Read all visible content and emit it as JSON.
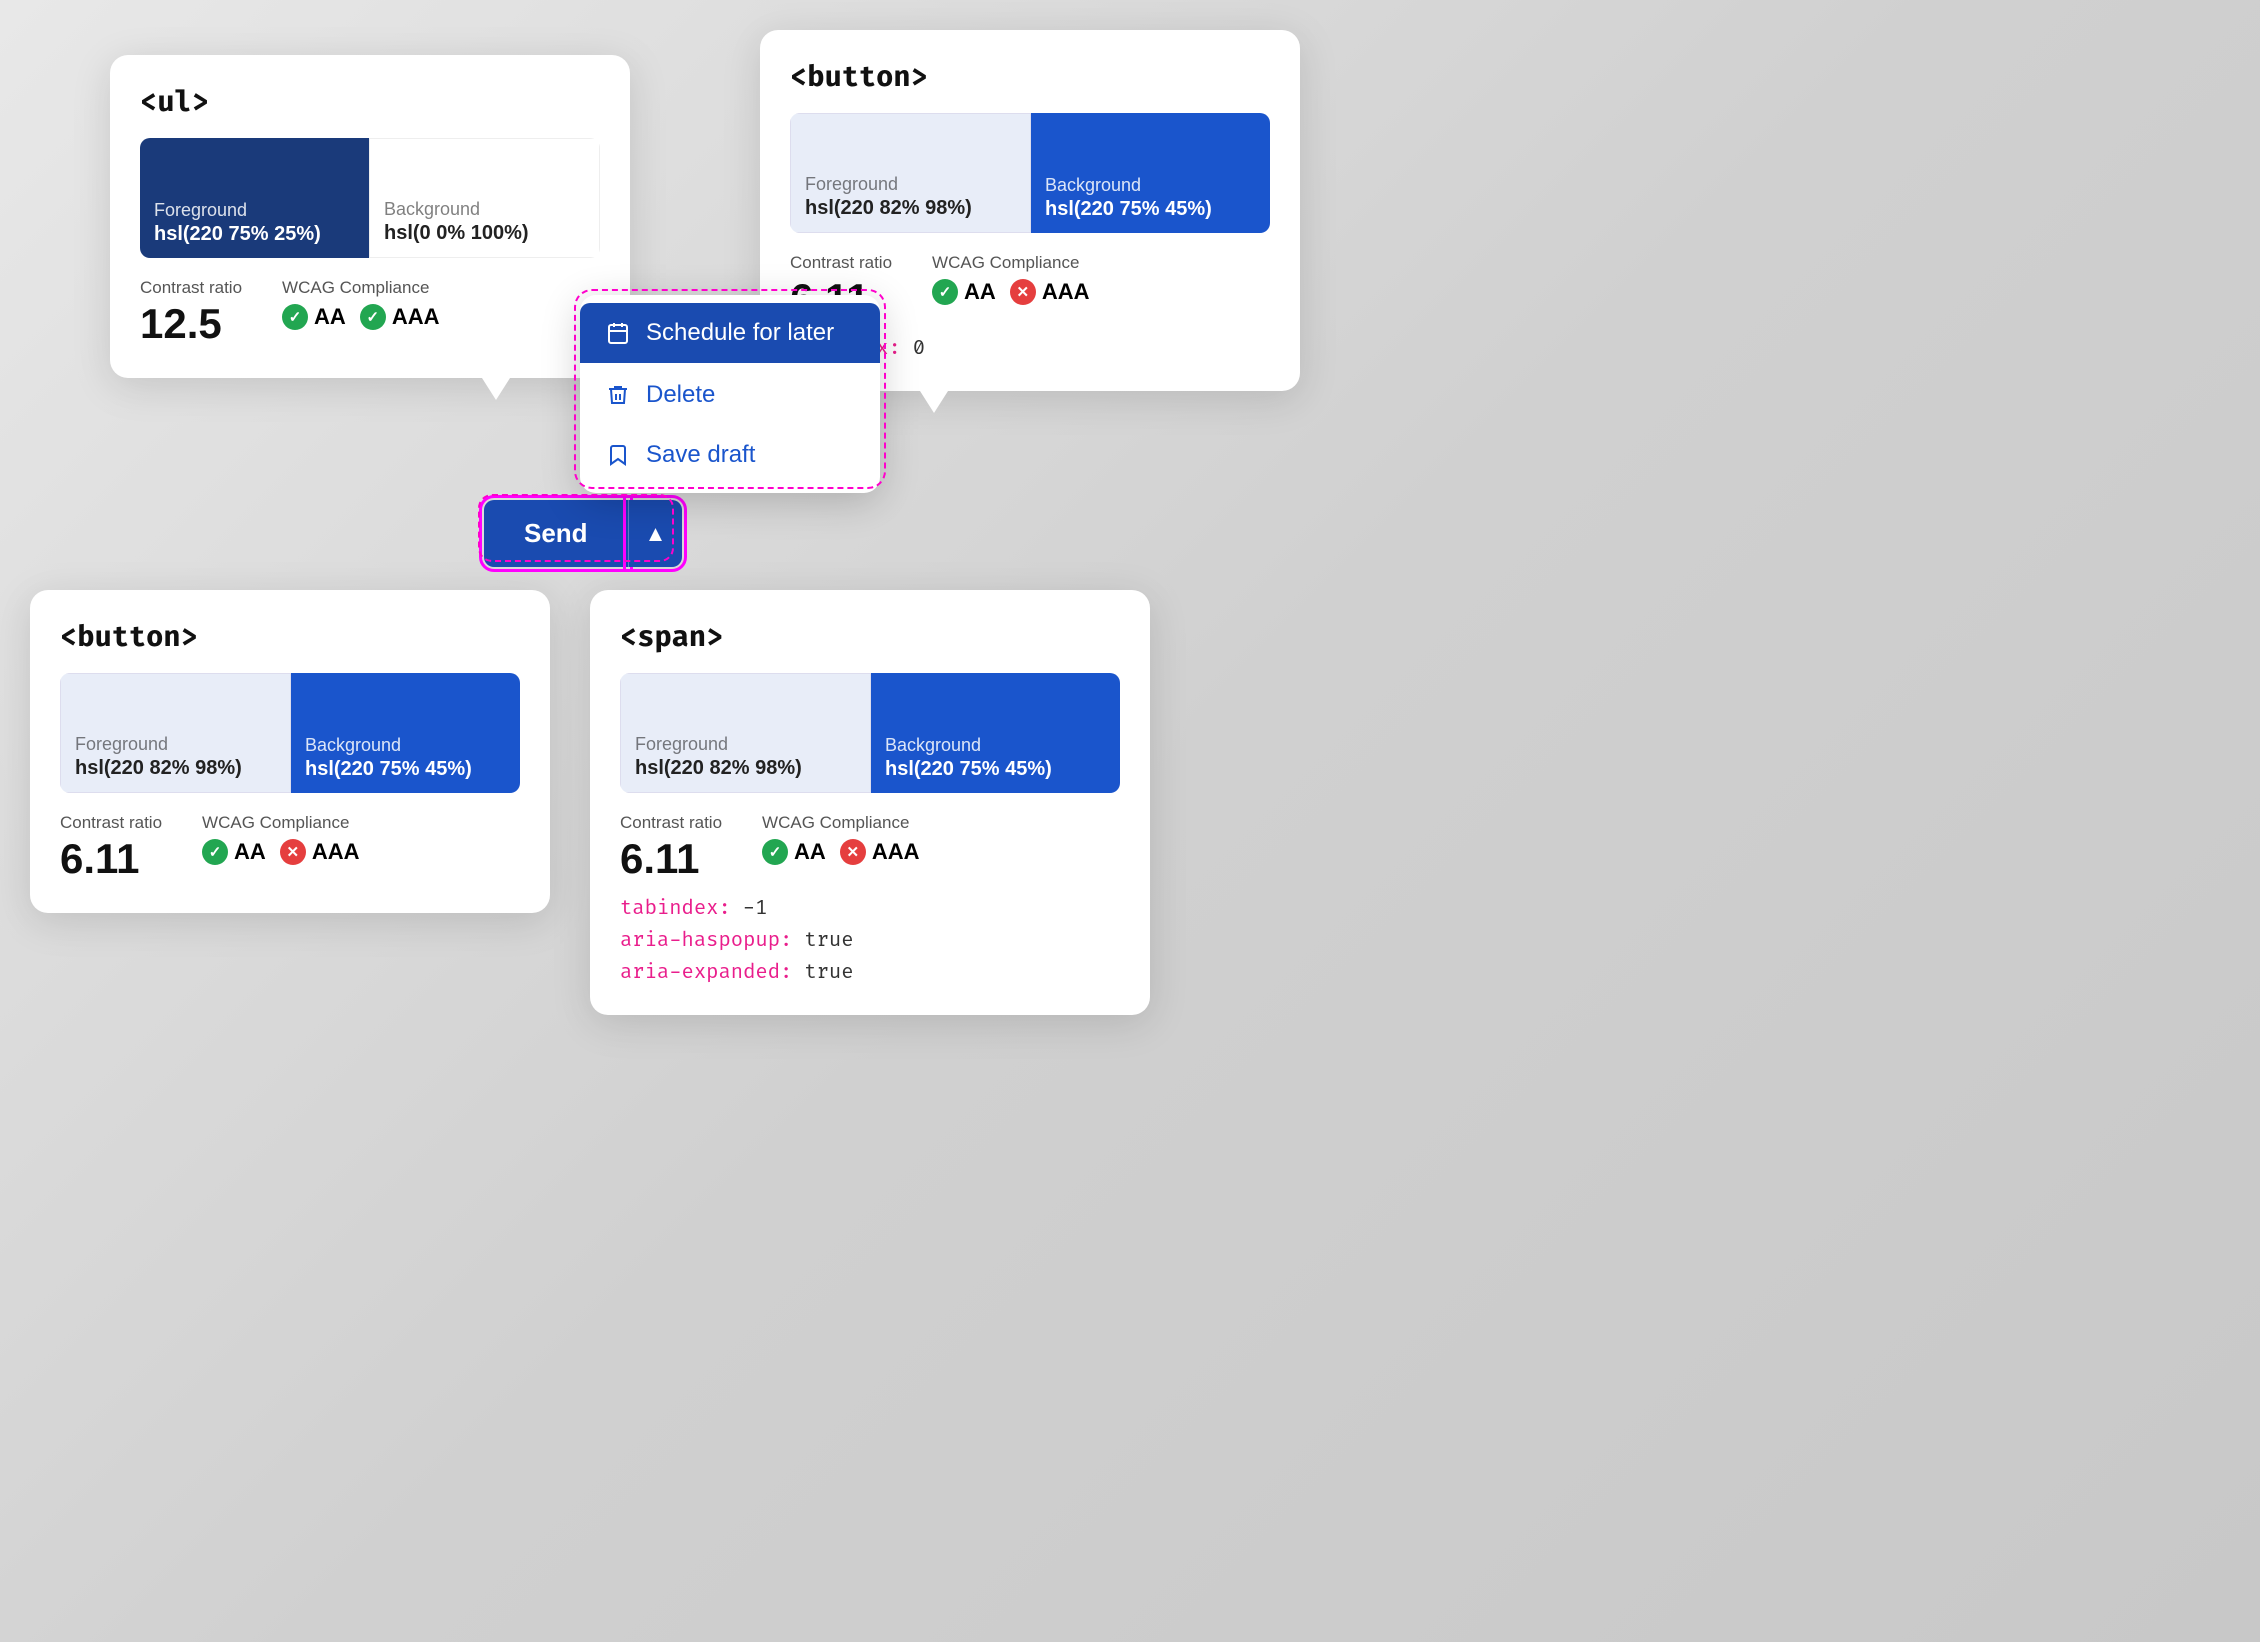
{
  "cards": {
    "ul": {
      "tag": "<ul>",
      "fg_label": "Foreground",
      "fg_value": "hsl(220 75% 25%)",
      "bg_label": "Background",
      "bg_value": "hsl(0 0% 100%)",
      "fg_color": "#1a3a7a",
      "bg_color": "#ffffff",
      "contrast_label": "Contrast ratio",
      "contrast_value": "12.5",
      "wcag_label": "WCAG Compliance",
      "aa_label": "AA",
      "aaa_label": "AAA",
      "aa_pass": true,
      "aaa_pass": true,
      "has_tabindex": false
    },
    "button_top": {
      "tag": "<button>",
      "fg_label": "Foreground",
      "fg_value": "hsl(220 82% 98%)",
      "bg_label": "Background",
      "bg_value": "hsl(220 75% 45%)",
      "fg_color": "#f0f4fe",
      "bg_color": "#1a55cc",
      "contrast_label": "Contrast ratio",
      "contrast_value": "6.11",
      "wcag_label": "WCAG Compliance",
      "aa_label": "AA",
      "aaa_label": "AAA",
      "aa_pass": true,
      "aaa_pass": false,
      "tabindex_label": "tabindex:",
      "tabindex_value": "0"
    },
    "button_bottom": {
      "tag": "<button>",
      "fg_label": "Foreground",
      "fg_value": "hsl(220 82% 98%)",
      "bg_label": "Background",
      "bg_value": "hsl(220 75% 45%)",
      "fg_color": "#f0f4fe",
      "bg_color": "#1a55cc",
      "contrast_label": "Contrast ratio",
      "contrast_value": "6.11",
      "wcag_label": "WCAG Compliance",
      "aa_label": "AA",
      "aaa_label": "AAA",
      "aa_pass": true,
      "aaa_pass": false,
      "has_tabindex": false
    },
    "span": {
      "tag": "<span>",
      "fg_label": "Foreground",
      "fg_value": "hsl(220 82% 98%)",
      "bg_label": "Background",
      "bg_value": "hsl(220 75% 45%)",
      "fg_color": "#f0f4fe",
      "bg_color": "#1a55cc",
      "contrast_label": "Contrast ratio",
      "contrast_value": "6.11",
      "wcag_label": "WCAG Compliance",
      "aa_label": "AA",
      "aaa_label": "AAA",
      "aa_pass": true,
      "aaa_pass": false,
      "tabindex_label": "tabindex:",
      "tabindex_value": "-1",
      "aria_haspopup_label": "aria-haspopup:",
      "aria_haspopup_value": "true",
      "aria_expanded_label": "aria-expanded:",
      "aria_expanded_value": "true"
    }
  },
  "dropdown": {
    "items": [
      {
        "label": "Schedule for later",
        "icon": "calendar"
      },
      {
        "label": "Delete",
        "icon": "trash"
      },
      {
        "label": "Save draft",
        "icon": "bookmark"
      }
    ]
  },
  "send_button": {
    "label": "Send",
    "chevron": "▲"
  }
}
